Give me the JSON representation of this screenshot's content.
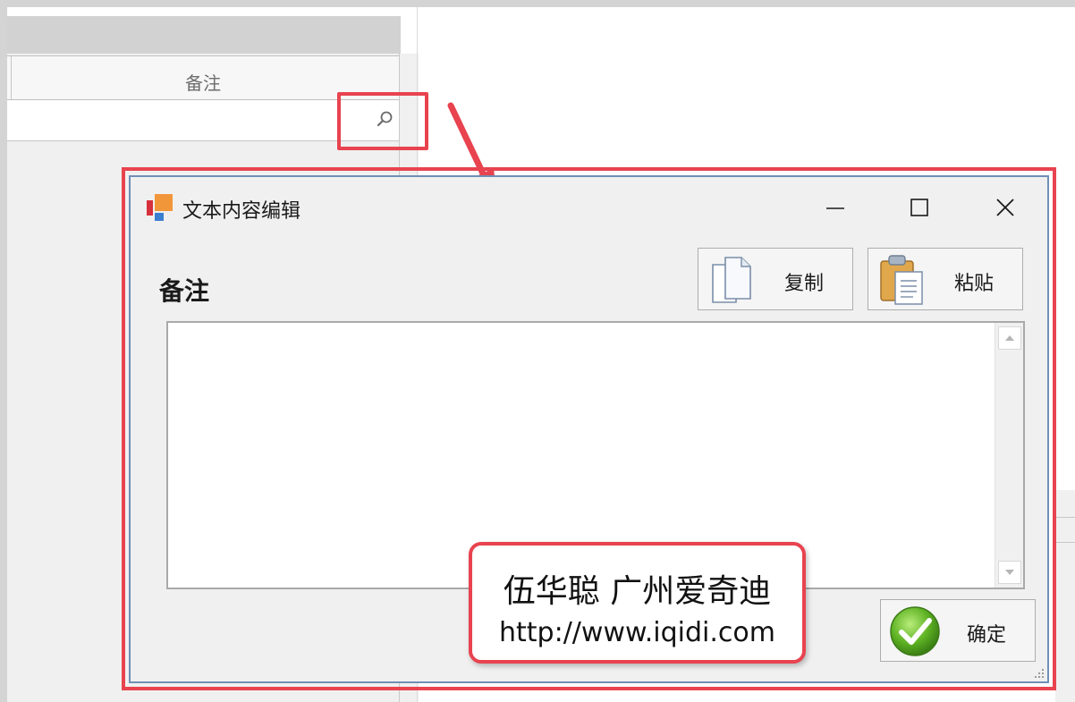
{
  "background_grid": {
    "column_header": "备注"
  },
  "dialog": {
    "title": "文本内容编辑",
    "field_label": "备注",
    "copy_button_label": "复制",
    "paste_button_label": "粘贴",
    "ok_button_label": "确定",
    "textarea_value": ""
  },
  "watermark": {
    "line1": "伍华聪 广州爱奇迪",
    "line2": "http://www.iqidi.com"
  },
  "colors": {
    "highlight": "#e8434f",
    "dialog_border": "#6f8fb5",
    "window_bg": "#f0f0f0"
  },
  "icons": {
    "search": "magnifier-icon",
    "app": "app-logo-icon",
    "copy": "copy-pages-icon",
    "paste": "clipboard-icon",
    "ok": "green-check-icon"
  }
}
